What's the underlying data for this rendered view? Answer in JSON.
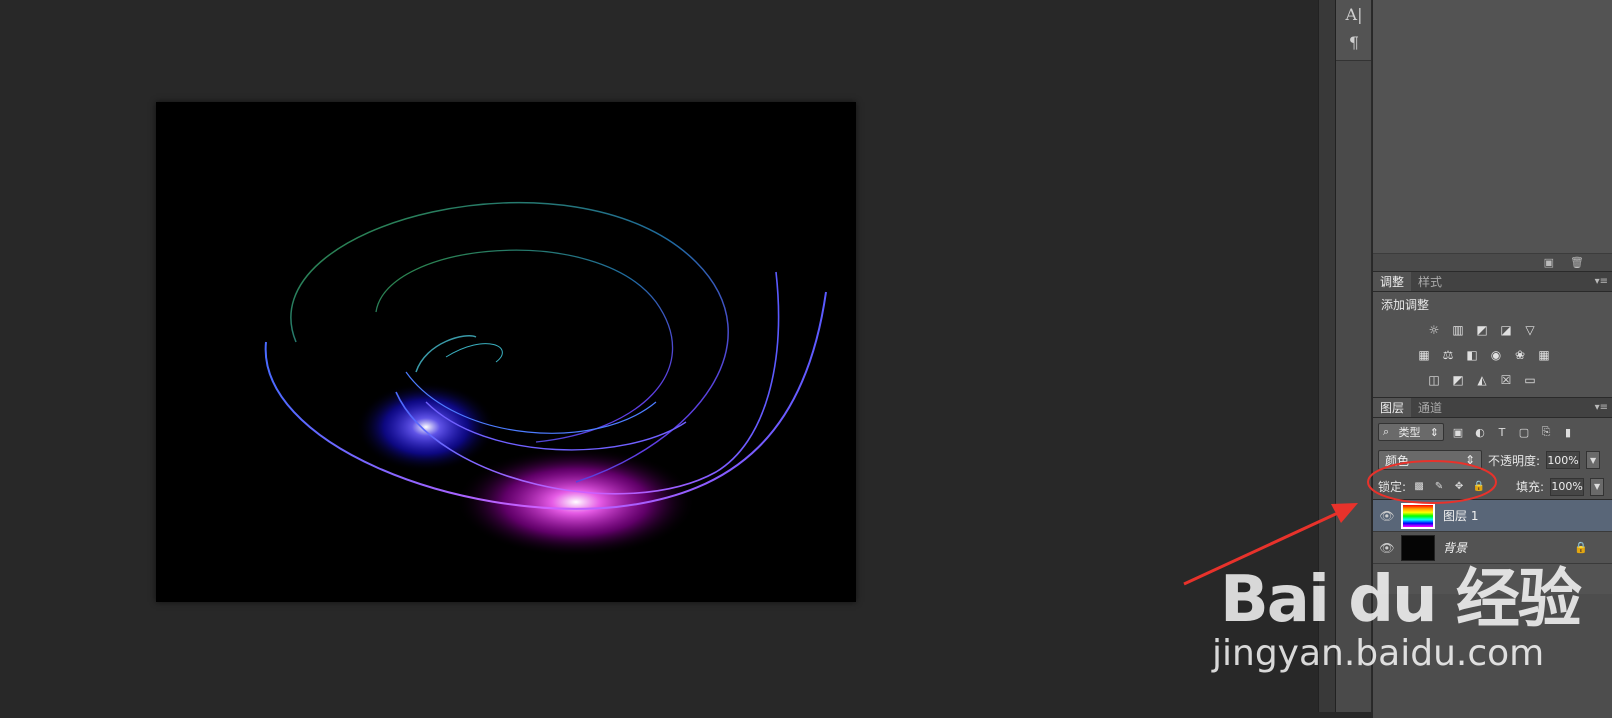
{
  "toolbar": {
    "tools": [
      {
        "glyph": "A|",
        "icon": "character-panel-icon"
      },
      {
        "glyph": "¶",
        "icon": "paragraph-panel-icon"
      }
    ]
  },
  "adjustments": {
    "tabs": [
      "调整",
      "样式"
    ],
    "title": "添加调整"
  },
  "layers": {
    "tabs": [
      "图层",
      "通道"
    ],
    "filter_label": "类型",
    "blend_mode": "颜色",
    "opacity_label": "不透明度:",
    "opacity_value": "100%",
    "lock_label": "锁定:",
    "fill_label": "填充:",
    "fill_value": "100%",
    "items": [
      {
        "name": "图层 1",
        "selected": true
      },
      {
        "name": "背景",
        "selected": false,
        "locked": true
      }
    ]
  },
  "watermark": {
    "logo_text": "Bai du 经验",
    "url": "jingyan.baidu.com"
  },
  "colors": {
    "annotation": "#e8322b",
    "selected_layer": "#596678",
    "panel_bg": "#535353",
    "canvas_bg": "#282828"
  }
}
